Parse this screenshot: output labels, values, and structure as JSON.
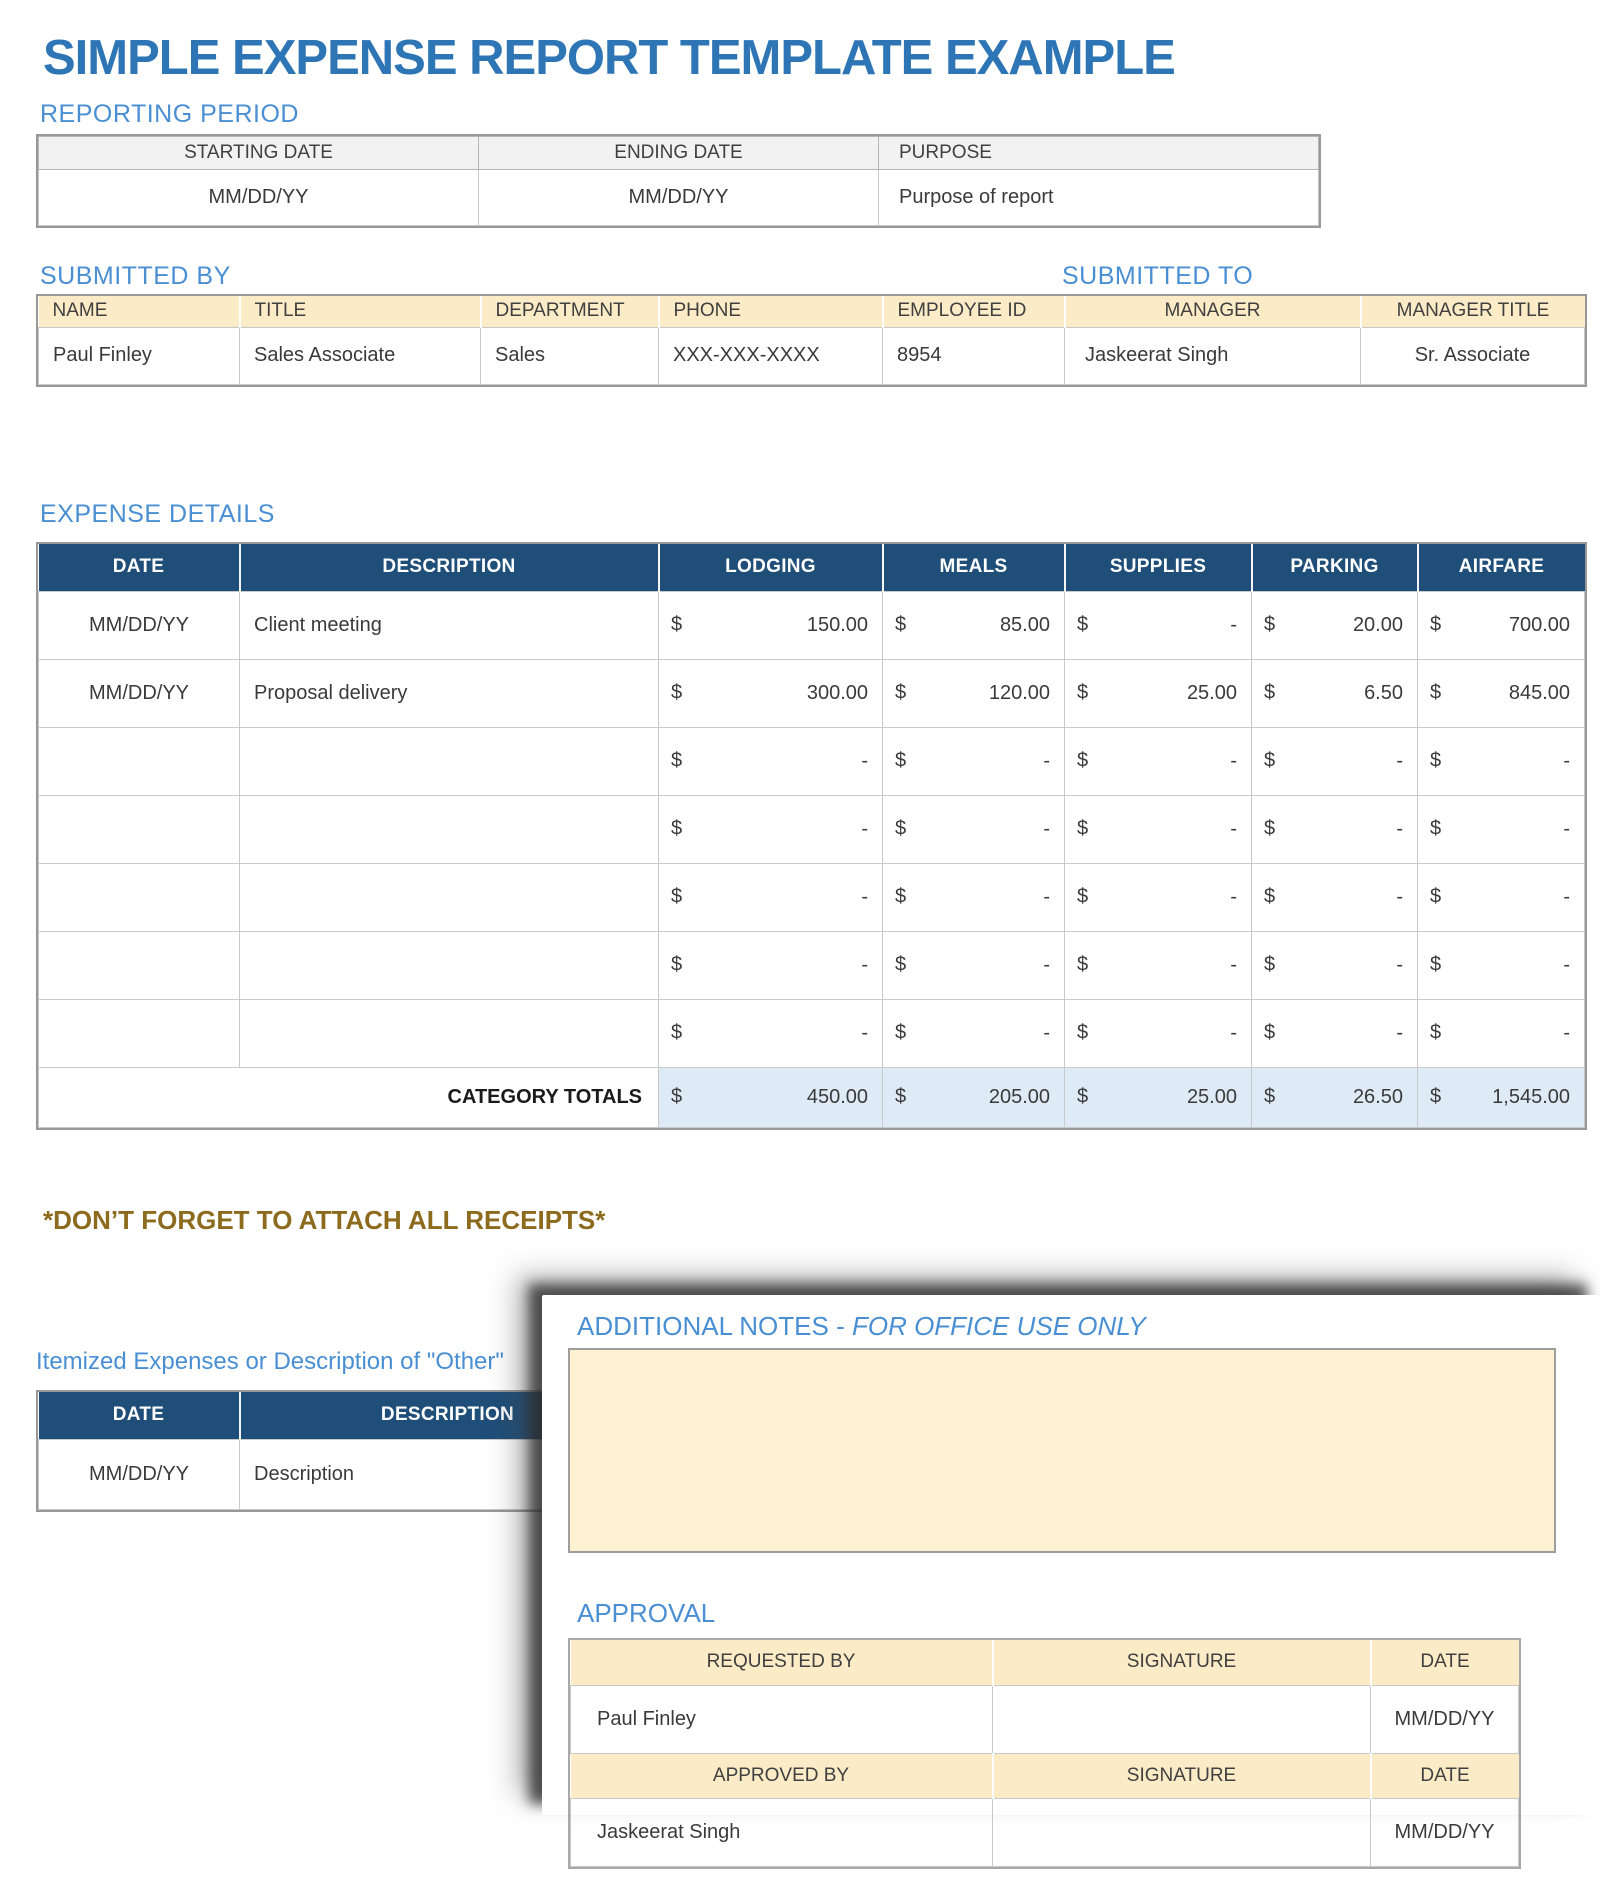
{
  "page": {
    "title": "SIMPLE EXPENSE REPORT TEMPLATE EXAMPLE"
  },
  "colors": {
    "title_blue": "#2E75B6",
    "heading_blue": "#4A8FD3",
    "header_navy": "#1F4E79",
    "header_cream": "#FBEBC6",
    "notes_cream": "#FCF1D0",
    "totals_blue": "#DEEAF6",
    "receipts_brown": "#8C6A1E"
  },
  "reporting_period": {
    "heading": "REPORTING PERIOD",
    "columns": [
      "STARTING DATE",
      "ENDING DATE",
      "PURPOSE"
    ],
    "row": {
      "starting_date": "MM/DD/YY",
      "ending_date": "MM/DD/YY",
      "purpose": "Purpose of report"
    }
  },
  "submitted": {
    "heading_by": "SUBMITTED BY",
    "heading_to": "SUBMITTED TO",
    "columns": [
      "NAME",
      "TITLE",
      "DEPARTMENT",
      "PHONE",
      "EMPLOYEE ID",
      "MANAGER",
      "MANAGER TITLE"
    ],
    "row": {
      "name": "Paul Finley",
      "title": "Sales Associate",
      "department": "Sales",
      "phone": "XXX-XXX-XXXX",
      "employee_id": "8954",
      "manager": "Jaskeerat Singh",
      "manager_title": "Sr. Associate"
    }
  },
  "expense": {
    "heading": "EXPENSE DETAILS",
    "columns": [
      "DATE",
      "DESCRIPTION",
      "LODGING",
      "MEALS",
      "SUPPLIES",
      "PARKING",
      "AIRFARE"
    ],
    "currency": "$",
    "rows": [
      {
        "date": "MM/DD/YY",
        "description": "Client meeting",
        "amounts": [
          "150.00",
          "85.00",
          "-",
          "20.00",
          "700.00"
        ]
      },
      {
        "date": "MM/DD/YY",
        "description": "Proposal delivery",
        "amounts": [
          "300.00",
          "120.00",
          "25.00",
          "6.50",
          "845.00"
        ]
      },
      {
        "date": "",
        "description": "",
        "amounts": [
          "-",
          "-",
          "-",
          "-",
          "-"
        ]
      },
      {
        "date": "",
        "description": "",
        "amounts": [
          "-",
          "-",
          "-",
          "-",
          "-"
        ]
      },
      {
        "date": "",
        "description": "",
        "amounts": [
          "-",
          "-",
          "-",
          "-",
          "-"
        ]
      },
      {
        "date": "",
        "description": "",
        "amounts": [
          "-",
          "-",
          "-",
          "-",
          "-"
        ]
      },
      {
        "date": "",
        "description": "",
        "amounts": [
          "-",
          "-",
          "-",
          "-",
          "-"
        ]
      }
    ],
    "totals_label": "CATEGORY TOTALS",
    "totals": [
      "450.00",
      "205.00",
      "25.00",
      "26.50",
      "1,545.00"
    ]
  },
  "receipts_note": "*DON’T FORGET TO ATTACH ALL RECEIPTS*",
  "itemized": {
    "heading": "Itemized Expenses or Description of \"Other\"",
    "columns": [
      "DATE",
      "DESCRIPTION"
    ],
    "row": {
      "date": "MM/DD/YY",
      "description": "Description"
    }
  },
  "notes_panel": {
    "heading_regular": "ADDITIONAL NOTES - ",
    "heading_italic": "FOR OFFICE USE ONLY",
    "approval_heading": "APPROVAL",
    "approval": {
      "requested": {
        "label": "REQUESTED BY",
        "signature_label": "SIGNATURE",
        "date_label": "DATE",
        "name": "Paul Finley",
        "date": "MM/DD/YY"
      },
      "approved": {
        "label": "APPROVED BY",
        "signature_label": "SIGNATURE",
        "date_label": "DATE",
        "name": "Jaskeerat Singh",
        "date": "MM/DD/YY"
      }
    }
  }
}
